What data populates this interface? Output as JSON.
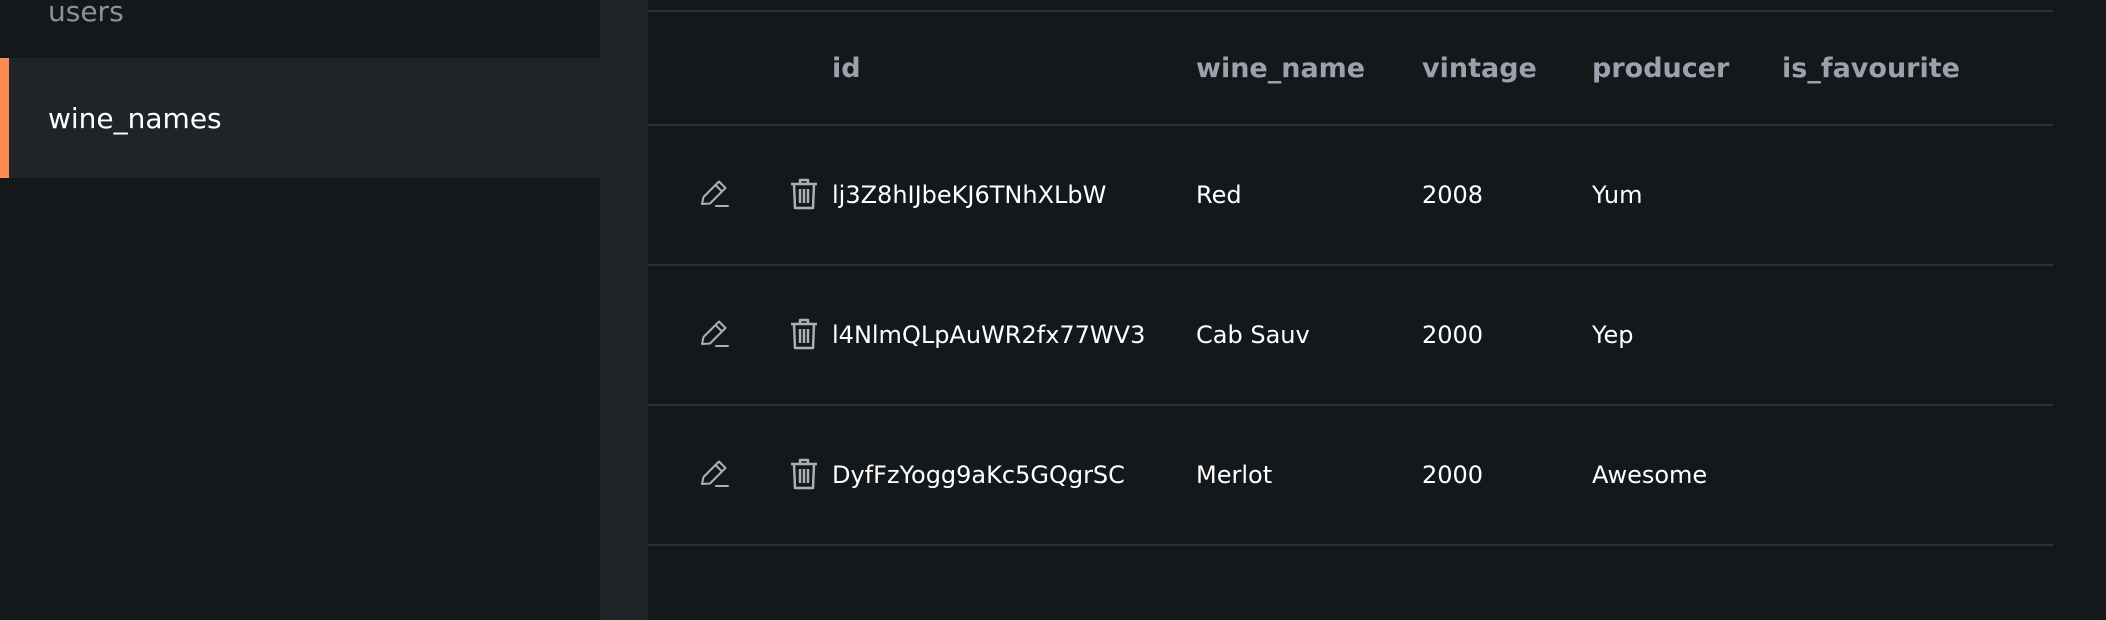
{
  "sidebar": {
    "items": [
      {
        "label": "users"
      },
      {
        "label": "wine_names"
      }
    ],
    "accent_color": "#ff8a54"
  },
  "table": {
    "columns": [
      "id",
      "wine_name",
      "vintage",
      "producer",
      "is_favourite"
    ],
    "rows": [
      {
        "id": "lj3Z8hIJbeKJ6TNhXLbW",
        "wine_name": "Red",
        "vintage": "2008",
        "producer": "Yum",
        "is_favourite": ""
      },
      {
        "id": "l4NlmQLpAuWR2fx77WV3",
        "wine_name": "Cab Sauv",
        "vintage": "2000",
        "producer": "Yep",
        "is_favourite": ""
      },
      {
        "id": "DyfFzYogg9aKc5GQgrSC",
        "wine_name": "Merlot",
        "vintage": "2000",
        "producer": "Awesome",
        "is_favourite": ""
      }
    ],
    "row_actions": {
      "edit_icon": "pencil-icon",
      "delete_icon": "trash-icon"
    }
  }
}
